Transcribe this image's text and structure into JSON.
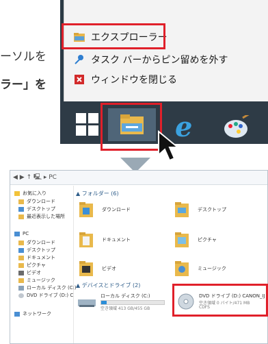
{
  "left_text": {
    "line1": "ーソルを",
    "line2": "ラー」を",
    "dot": "。"
  },
  "jumplist": {
    "items": [
      {
        "label": "エクスプローラー",
        "icon": "folder-icon"
      },
      {
        "label": "タスク バーからピン留めを外す",
        "icon": "unpin-icon"
      },
      {
        "label": "ウィンドウを閉じる",
        "icon": "close-icon"
      }
    ]
  },
  "taskbar": {
    "icons": [
      "windows-logo-icon",
      "file-explorer-icon",
      "internet-explorer-icon",
      "paint-icon"
    ],
    "ie_glyph": "e"
  },
  "explorer": {
    "address": "◀ ▶ ↑ 🖳 ▸ PC",
    "nav": {
      "favorites_label": "お気に入り",
      "favorites": [
        "ダウンロード",
        "デスクトップ",
        "最近表示した場所"
      ],
      "pc_label": "PC",
      "pc_items": [
        "ダウンロード",
        "デスクトップ",
        "ドキュメント",
        "ピクチャ",
        "ビデオ",
        "ミュージック",
        "ローカル ディスク (C:)",
        "DVD ドライブ (D:) C"
      ],
      "network_label": "ネットワーク"
    },
    "folders_header": "▲ フォルダー (6)",
    "folders": [
      "ダウンロード",
      "デスクトップ",
      "ドキュメント",
      "ピクチャ",
      "ビデオ",
      "ミュージック"
    ],
    "drives_header": "▲ デバイスとドライブ (2)",
    "drives": [
      {
        "name": "ローカル ディスク (C:)",
        "detail": "空き領域 413 GB/455 GB",
        "fill_fraction": 0.09
      },
      {
        "name": "DVD ドライブ (D:) CANON_IJ",
        "detail": "空き領域 0 バイト/471 MB",
        "fs": "CDFS"
      }
    ]
  },
  "colors": {
    "highlight": "#e0202a",
    "taskbar": "#2e3b46",
    "arrow": "#9aa9b5"
  }
}
